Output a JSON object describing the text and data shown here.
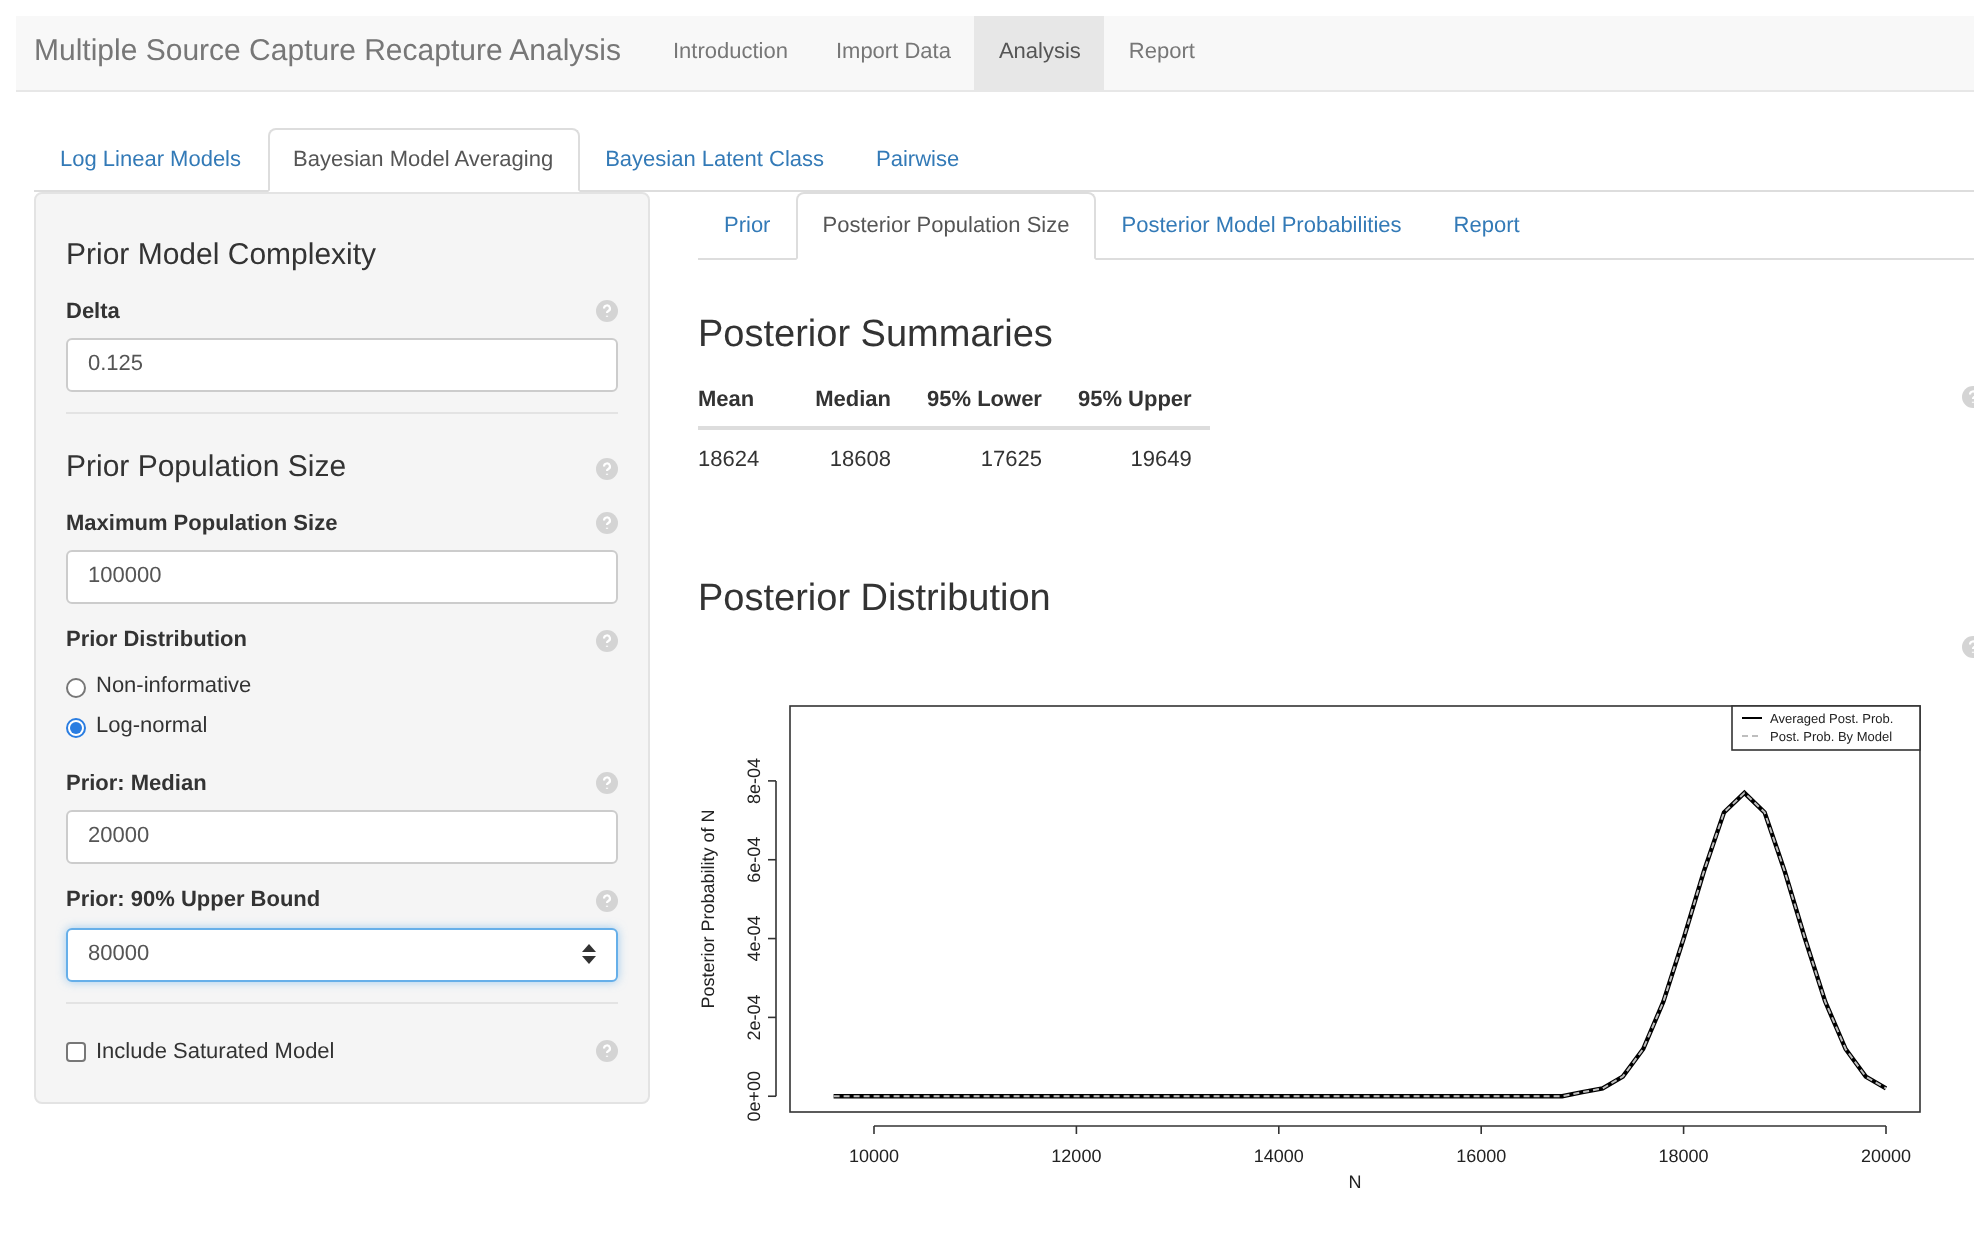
{
  "navbar": {
    "brand": "Multiple Source Capture Recapture Analysis",
    "items": [
      {
        "label": "Introduction",
        "selected": false
      },
      {
        "label": "Import Data",
        "selected": false
      },
      {
        "label": "Analysis",
        "selected": true
      },
      {
        "label": "Report",
        "selected": false
      }
    ]
  },
  "tabs": [
    {
      "label": "Log Linear Models",
      "selected": false
    },
    {
      "label": "Bayesian Model Averaging",
      "selected": true
    },
    {
      "label": "Bayesian Latent Class",
      "selected": false
    },
    {
      "label": "Pairwise",
      "selected": false
    }
  ],
  "sidebar": {
    "sections": [
      {
        "title": "Prior Model Complexity",
        "help": false,
        "controls": [
          {
            "kind": "input",
            "label": "Delta",
            "help": true,
            "value": "0.125",
            "focused": false
          }
        ]
      },
      {
        "title": "Prior Population Size",
        "help": true,
        "controls": [
          {
            "kind": "input",
            "label": "Maximum Population Size",
            "help": true,
            "value": "100000",
            "focused": false
          },
          {
            "kind": "radio",
            "label": "Prior Distribution",
            "help": true,
            "options": [
              {
                "label": "Non-informative",
                "selected": false
              },
              {
                "label": "Log-normal",
                "selected": true
              }
            ]
          },
          {
            "kind": "input",
            "label": "Prior: Median",
            "help": true,
            "value": "20000",
            "focused": false
          },
          {
            "kind": "input",
            "label": "Prior: 90% Upper Bound",
            "help": true,
            "value": "80000",
            "focused": true
          }
        ]
      },
      {
        "controls": [
          {
            "kind": "checkbox",
            "label": "Include Saturated Model",
            "help": true,
            "checked": false
          }
        ]
      }
    ]
  },
  "subtabs": [
    {
      "label": "Prior",
      "selected": false
    },
    {
      "label": "Posterior Population Size",
      "selected": true
    },
    {
      "label": "Posterior Model Probabilities",
      "selected": false
    },
    {
      "label": "Report",
      "selected": false
    }
  ],
  "summaries": {
    "title": "Posterior Summaries",
    "columns": [
      "Mean",
      "Median",
      "95% Lower",
      "95% Upper"
    ],
    "rows": [
      [
        "18624",
        "18608",
        "17625",
        "19649"
      ]
    ]
  },
  "distribution": {
    "title": "Posterior Distribution",
    "chart_data": {
      "type": "line",
      "xlabel": "N",
      "ylabel": "Posterior Probability of N",
      "x": [
        9600,
        10000,
        10400,
        10800,
        11200,
        11600,
        12000,
        12400,
        12800,
        13200,
        13600,
        14000,
        14400,
        14800,
        15200,
        15600,
        16000,
        16400,
        16800,
        17000,
        17200,
        17400,
        17600,
        17800,
        18000,
        18200,
        18400,
        18600,
        18800,
        19000,
        19200,
        19400,
        19600,
        19800,
        20000
      ],
      "series": [
        {
          "name": "Averaged Post. Prob.",
          "color": "#000000",
          "line_style": "solid",
          "values": [
            0,
            0,
            0,
            0,
            0,
            0,
            0,
            0,
            0,
            0,
            0,
            0,
            0,
            0,
            0,
            0,
            0,
            0,
            0,
            1e-05,
            2e-05,
            5e-05,
            0.00012,
            0.00024,
            0.0004,
            0.00057,
            0.00072,
            0.00077,
            0.00072,
            0.00057,
            0.0004,
            0.00024,
            0.00012,
            5e-05,
            2e-05
          ]
        },
        {
          "name": "Post. Prob. By Model",
          "color": "#bebebe",
          "line_style": "dashed",
          "values": [
            0,
            0,
            0,
            0,
            0,
            0,
            0,
            0,
            0,
            0,
            0,
            0,
            0,
            0,
            0,
            0,
            0,
            0,
            0,
            1e-05,
            2e-05,
            5e-05,
            0.00012,
            0.00024,
            0.0004,
            0.00057,
            0.00072,
            0.00077,
            0.00072,
            0.00057,
            0.0004,
            0.00024,
            0.00012,
            5e-05,
            2e-05
          ]
        }
      ],
      "legend": true,
      "xlim": [
        9170,
        20336
      ],
      "ylim": [
        -4e-05,
        0.00099
      ],
      "xticks": [
        10000,
        12000,
        14000,
        16000,
        18000,
        20000
      ],
      "yticks": [
        {
          "value": 0,
          "label": "0e+00"
        },
        {
          "value": 0.0002,
          "label": "2e-04"
        },
        {
          "value": 0.0004,
          "label": "4e-04"
        },
        {
          "value": 0.0006,
          "label": "6e-04"
        },
        {
          "value": 0.0008,
          "label": "8e-04"
        }
      ]
    }
  }
}
